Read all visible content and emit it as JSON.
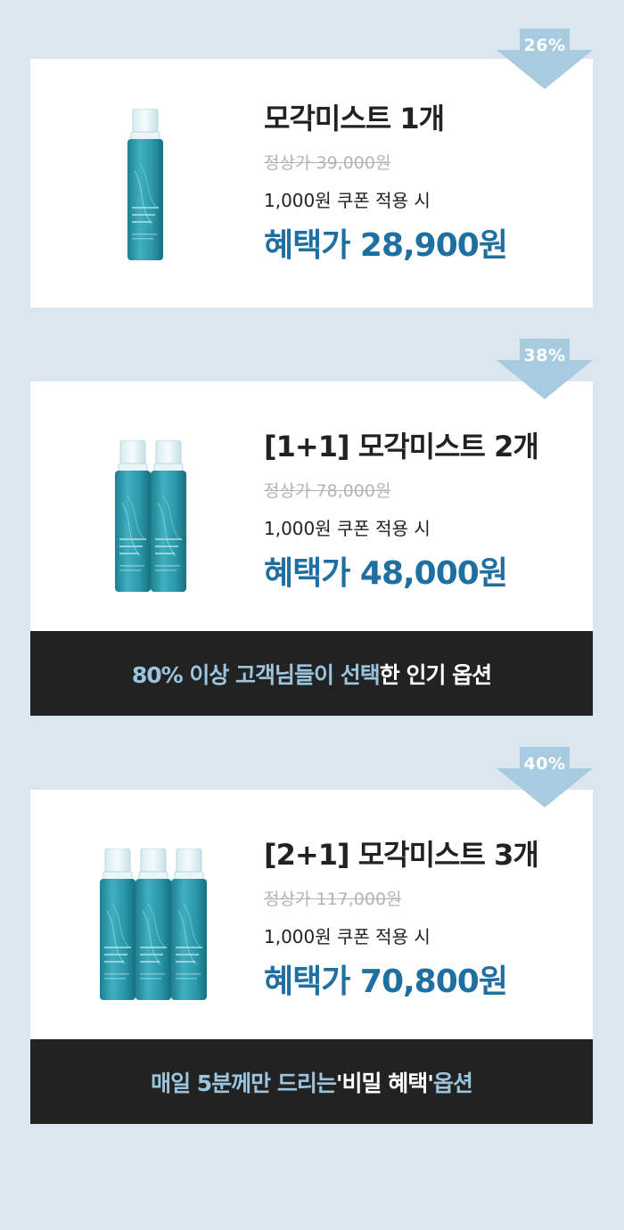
{
  "accent_color": "#1f6fa0",
  "badge_color": "#a9cbe0",
  "options": [
    {
      "badge": "26%",
      "title": "모각미스트 1개",
      "original_price": "정상가 39,000원",
      "coupon": "1,000원 쿠폰 적용 시",
      "sale_price": "혜택가 28,900원",
      "bottle_count": 1
    },
    {
      "badge": "38%",
      "title": "[1+1] 모각미스트 2개",
      "original_price": "정상가 78,000원",
      "coupon": "1,000원 쿠폰 적용 시",
      "sale_price": "혜택가 48,000원",
      "bottle_count": 2,
      "banner": {
        "highlight_1": "80% 이상 고객님들이 선택",
        "plain": "한 인기 옵션"
      }
    },
    {
      "badge": "40%",
      "title": "[2+1] 모각미스트 3개",
      "original_price": "정상가 117,000원",
      "coupon": "1,000원 쿠폰 적용 시",
      "sale_price": "혜택가 70,800원",
      "bottle_count": 3,
      "banner": {
        "highlight_1": "매일 5분께만 드리는",
        "plain": " '비밀 혜택' ",
        "highlight_2": "옵션"
      }
    }
  ]
}
